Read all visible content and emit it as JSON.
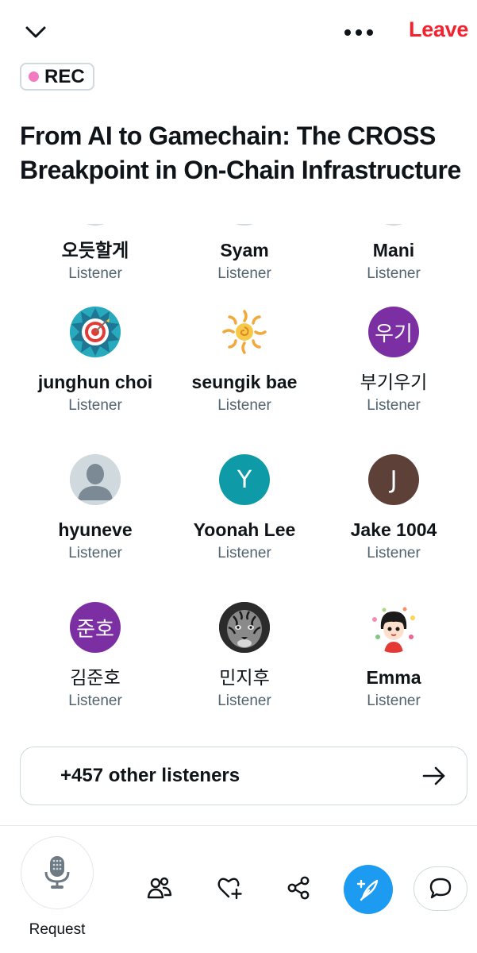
{
  "header": {
    "collapse_icon": "chevron-down-icon",
    "more_icon": "more-horizontal-icon",
    "leave_label": "Leave",
    "leave_color": "#f4212e"
  },
  "rec_badge": {
    "label": "REC",
    "dot_color": "#f37ac0"
  },
  "space": {
    "title": "From AI to Gamechain: The CROSS Breakpoint in On-Chain Infrastructure"
  },
  "listeners": [
    {
      "name": "오듯할게",
      "role": "Listener"
    },
    {
      "name": "Syam",
      "role": "Listener"
    },
    {
      "name": "Mani",
      "role": "Listener"
    },
    {
      "name": "junghun choi",
      "role": "Listener",
      "avatar": "target-image"
    },
    {
      "name": "seungik bae",
      "role": "Listener",
      "avatar": "sun-image"
    },
    {
      "name": "부기우기",
      "role": "Listener",
      "avatar_text": "우기",
      "avatar_color": "#7c2fa3"
    },
    {
      "name": "hyuneve",
      "role": "Listener",
      "avatar": "default-person"
    },
    {
      "name": "Yoonah Lee",
      "role": "Listener",
      "avatar_text": "Y",
      "avatar_color": "#0f9aa8"
    },
    {
      "name": "Jake 1004",
      "role": "Listener",
      "avatar_text": "J",
      "avatar_color": "#5d4037"
    },
    {
      "name": "김준호",
      "role": "Listener",
      "avatar_text": "준호",
      "avatar_color": "#7c2fa3"
    },
    {
      "name": "민지후",
      "role": "Listener",
      "avatar": "tiger-photo"
    },
    {
      "name": "Emma",
      "role": "Listener",
      "avatar": "cartoon-girl"
    }
  ],
  "others": {
    "label": "+457 other listeners",
    "icon": "arrow-right-icon"
  },
  "bottom_bar": {
    "request_label": "Request",
    "request_icon": "microphone-icon",
    "people_icon": "people-icon",
    "heart_icon": "heart-plus-icon",
    "share_icon": "share-icon",
    "compose_icon": "compose-feather-icon",
    "chat_icon": "chat-bubble-icon",
    "accent": "#1d9bf0"
  }
}
